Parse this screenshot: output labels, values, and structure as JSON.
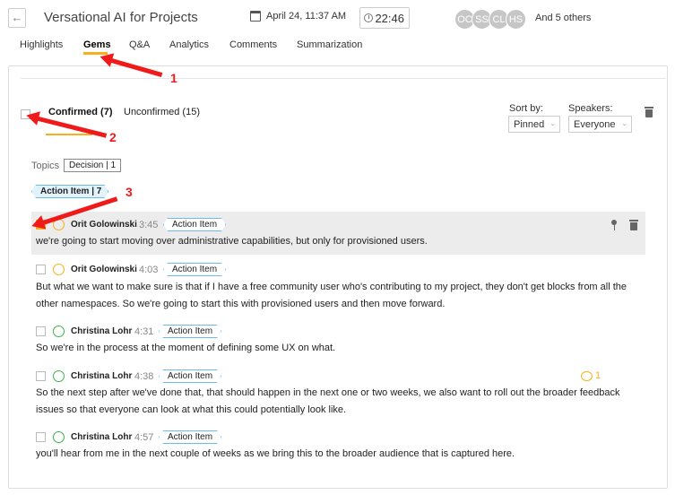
{
  "header": {
    "title": "Versational AI for Projects",
    "date": "April 24, 11:37 AM",
    "duration": "22:46",
    "avatars": [
      "OC",
      "SS",
      "CL",
      "HS"
    ],
    "others": "And 5 others"
  },
  "tabs": [
    {
      "label": "Highlights",
      "active": false
    },
    {
      "label": "Gems",
      "active": true
    },
    {
      "label": "Q&A",
      "active": false
    },
    {
      "label": "Analytics",
      "active": false
    },
    {
      "label": "Comments",
      "active": false
    },
    {
      "label": "Summarization",
      "active": false
    }
  ],
  "filters": {
    "confirmed": "Confirmed (7)",
    "unconfirmed": "Unconfirmed (15)",
    "sort_label": "Sort by:",
    "sort_value": "Pinned",
    "speakers_label": "Speakers:",
    "speakers_value": "Everyone"
  },
  "topics": {
    "label": "Topics",
    "chip": "Decision | 1",
    "active_tag": "Action Item | 7"
  },
  "gems": [
    {
      "speaker": "Orit Golowinski",
      "time": "3:45",
      "tag": "Action Item",
      "checked": true,
      "text": "we're going to start moving over administrative capabilities, but only for provisioned users."
    },
    {
      "speaker": "Orit Golowinski",
      "time": "4:03",
      "tag": "Action Item",
      "checked": false,
      "text": "But what we want to make sure is that if I have a free community user who's contributing to my project, they don't get blocks from all the other namespaces. So we're going to start this with provisioned users and then move forward."
    },
    {
      "speaker": "Christina Lohr",
      "time": "4:31",
      "tag": "Action Item",
      "checked": false,
      "text": "So we're in the process at the moment of defining some UX on what."
    },
    {
      "speaker": "Christina Lohr",
      "time": "4:38",
      "tag": "Action Item",
      "checked": false,
      "comments": "1",
      "text": "So the next step after we've done that, that should happen in the next one or two weeks, we also want to roll out the broader feedback issues so that everyone can look at what this could potentially look like."
    },
    {
      "speaker": "Christina Lohr",
      "time": "4:57",
      "tag": "Action Item",
      "checked": false,
      "text": "you'll hear from me in the next couple of weeks as we bring this to the broader audience that is captured here."
    }
  ],
  "annotations": [
    "1",
    "2",
    "3"
  ],
  "colors": {
    "accent": "#f7b01a",
    "annotation": "#ef1b1b",
    "tag_border": "#6bbde8",
    "speaker_green": "#3cb34a"
  }
}
